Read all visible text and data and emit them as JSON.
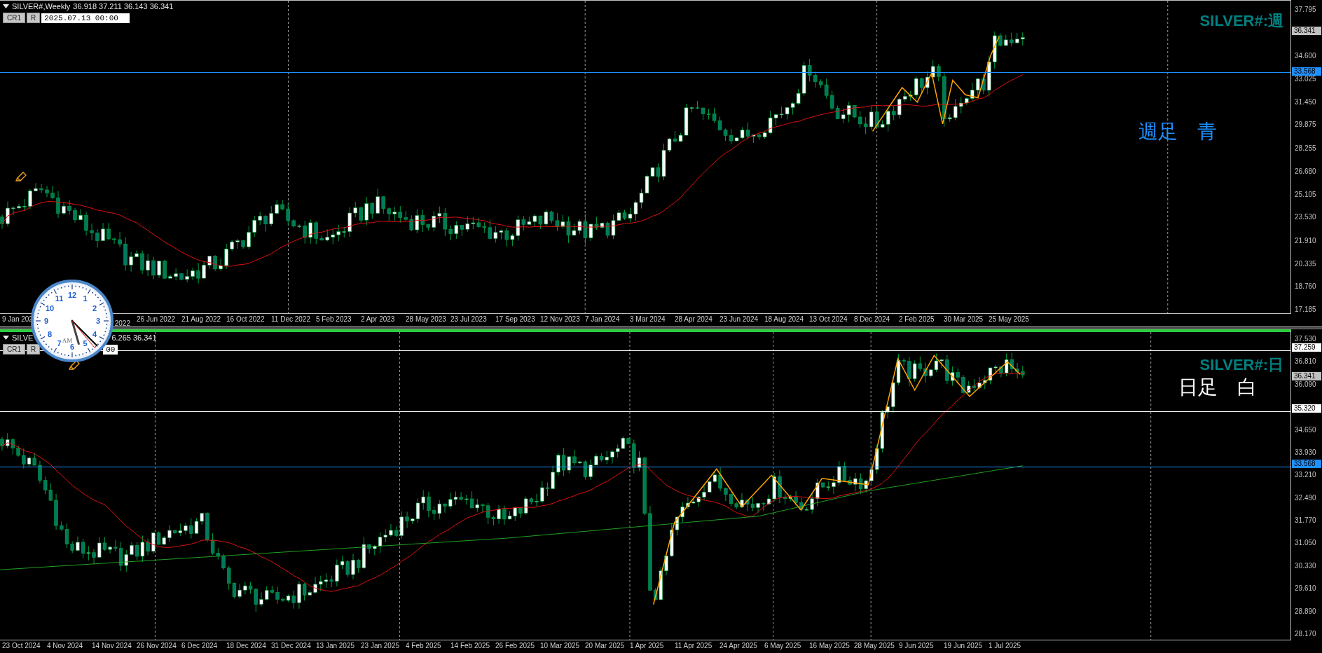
{
  "panels": [
    {
      "header": {
        "title": "SILVER#,Weekly",
        "ohlc": "36.918 37.211 36.143 36.341"
      },
      "buttons": [
        "CR1",
        "R"
      ],
      "date_field": "2025.07.13 00:00",
      "chart_label": "SILVER#:週",
      "note": {
        "text": "週足　青",
        "color": "#1e90ff"
      },
      "y_labels": [
        "37.795",
        "34.600",
        "33.025",
        "31.450",
        "29.875",
        "28.255",
        "26.680",
        "25.105",
        "23.530",
        "21.910",
        "20.335",
        "18.760",
        "17.185"
      ],
      "price_tags": [
        {
          "text": "36.341",
          "kind": "bid"
        },
        {
          "text": "33.568",
          "kind": "line",
          "color": "#1e90ff"
        }
      ],
      "x_labels": [
        {
          "text": "9 Jan 202",
          "kind": "full"
        },
        {
          "text": "2022",
          "kind": "tail"
        },
        {
          "text": "26 Jun 2022",
          "kind": "full"
        },
        {
          "text": "21 Aug 2022",
          "kind": "full"
        },
        {
          "text": "16 Oct 2022",
          "kind": "full"
        },
        {
          "text": "11 Dec 2022",
          "kind": "full"
        },
        {
          "text": "5 Feb 2023",
          "kind": "full"
        },
        {
          "text": "2 Apr 2023",
          "kind": "full"
        },
        {
          "text": "28 May 2023",
          "kind": "full"
        },
        {
          "text": "23 Jul 2023",
          "kind": "full"
        },
        {
          "text": "17 Sep 2023",
          "kind": "full"
        },
        {
          "text": "12 Nov 2023",
          "kind": "full"
        },
        {
          "text": "7 Jan 2024",
          "kind": "full"
        },
        {
          "text": "3 Mar 2024",
          "kind": "full"
        },
        {
          "text": "28 Apr 2024",
          "kind": "full"
        },
        {
          "text": "23 Jun 2024",
          "kind": "full"
        },
        {
          "text": "18 Aug 2024",
          "kind": "full"
        },
        {
          "text": "13 Oct 2024",
          "kind": "full"
        },
        {
          "text": "8 Dec 2024",
          "kind": "full"
        },
        {
          "text": "2 Feb 2025",
          "kind": "full"
        },
        {
          "text": "30 Mar 2025",
          "kind": "full"
        },
        {
          "text": "25 May 2025",
          "kind": "full"
        }
      ]
    },
    {
      "header": {
        "title": "SILVE",
        "ohlc": "6.265 36.341"
      },
      "buttons": [
        "CR1",
        "R"
      ],
      "date_field": "00",
      "chart_label": "SILVER#:日",
      "note": {
        "text": "日足　白",
        "color": "#ffffff"
      },
      "y_labels": [
        "37.530",
        "36.810",
        "36.090",
        "34.650",
        "33.930",
        "33.210",
        "32.490",
        "31.770",
        "31.050",
        "30.330",
        "29.610",
        "28.890",
        "28.170"
      ],
      "price_tags": [
        {
          "text": "37.259",
          "kind": "line",
          "color": "#ffffff"
        },
        {
          "text": "36.341",
          "kind": "bid"
        },
        {
          "text": "35.320",
          "kind": "line",
          "color": "#ffffff"
        },
        {
          "text": "33.568",
          "kind": "line",
          "color": "#1e90ff"
        }
      ],
      "x_labels": [
        {
          "text": "23 Oct 2024",
          "kind": "full"
        },
        {
          "text": "4 Nov 2024",
          "kind": "full"
        },
        {
          "text": "14 Nov 2024",
          "kind": "full"
        },
        {
          "text": "26 Nov 2024",
          "kind": "full"
        },
        {
          "text": "6 Dec 2024",
          "kind": "full"
        },
        {
          "text": "18 Dec 2024",
          "kind": "full"
        },
        {
          "text": "31 Dec 2024",
          "kind": "full"
        },
        {
          "text": "13 Jan 2025",
          "kind": "full"
        },
        {
          "text": "23 Jan 2025",
          "kind": "full"
        },
        {
          "text": "4 Feb 2025",
          "kind": "full"
        },
        {
          "text": "14 Feb 2025",
          "kind": "full"
        },
        {
          "text": "26 Feb 2025",
          "kind": "full"
        },
        {
          "text": "10 Mar 2025",
          "kind": "full"
        },
        {
          "text": "20 Mar 2025",
          "kind": "full"
        },
        {
          "text": "1 Apr 2025",
          "kind": "full"
        },
        {
          "text": "11 Apr 2025",
          "kind": "full"
        },
        {
          "text": "24 Apr 2025",
          "kind": "full"
        },
        {
          "text": "6 May 2025",
          "kind": "full"
        },
        {
          "text": "16 May 2025",
          "kind": "full"
        },
        {
          "text": "28 May 2025",
          "kind": "full"
        },
        {
          "text": "9 Jun 2025",
          "kind": "full"
        },
        {
          "text": "19 Jun 2025",
          "kind": "full"
        },
        {
          "text": "1 Jul 2025",
          "kind": "full"
        }
      ]
    }
  ],
  "clock": {
    "numerals": [
      "12",
      "11",
      "1",
      "10",
      "2",
      "9",
      "3",
      "8",
      "4",
      "7",
      "5",
      "6"
    ],
    "period": "AM"
  }
}
